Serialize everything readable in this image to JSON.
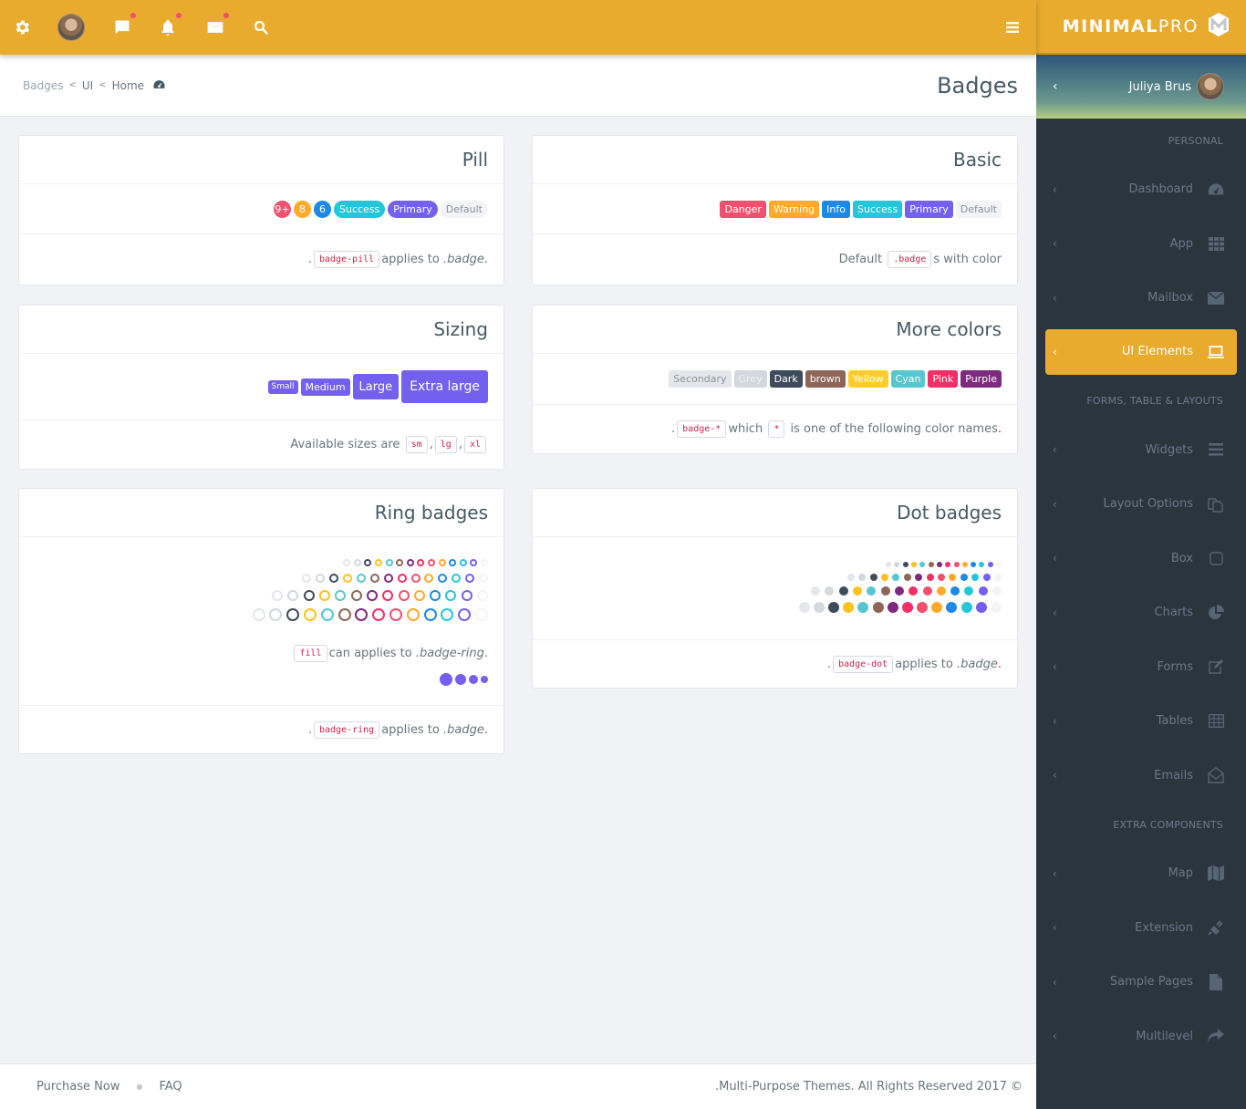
{
  "topbar": {
    "icons": [
      "gear-icon",
      "avatar",
      "chat-icon",
      "bell-icon",
      "envelope-icon",
      "search-icon"
    ],
    "menu_icon": "hamburger-icon"
  },
  "brand": {
    "bold": "MINIMAL",
    "light": "PRO"
  },
  "user": {
    "name": "Juliya Brus"
  },
  "breadcrumb": {
    "items": [
      "Badges",
      "UI",
      "Home"
    ],
    "home_icon": "dashboard-icon"
  },
  "page_title": "Badges",
  "cards": {
    "pill": {
      "title": "Pill",
      "badges": [
        {
          "label": "9+",
          "color": "#f0506e",
          "shape": "circle"
        },
        {
          "label": "8",
          "color": "#ffaa2b",
          "shape": "circle"
        },
        {
          "label": "6",
          "color": "#1e88e5",
          "shape": "circle"
        },
        {
          "label": "Success",
          "color": "#26c6da",
          "shape": "pill"
        },
        {
          "label": "Primary",
          "color": "#7460ee",
          "shape": "pill"
        },
        {
          "label": "Default",
          "color": "#f3f4f7",
          "text_color": "#8a939b",
          "shape": "pill"
        }
      ],
      "footer": {
        "code": "badge-pill",
        "text": "applies to",
        "ref": ".badge"
      }
    },
    "basic": {
      "title": "Basic",
      "badges": [
        {
          "label": "Danger",
          "color": "#f0506e"
        },
        {
          "label": "Warning",
          "color": "#ffaa2b"
        },
        {
          "label": "Info",
          "color": "#1e88e5"
        },
        {
          "label": "Success",
          "color": "#26c6da"
        },
        {
          "label": "Primary",
          "color": "#7460ee"
        },
        {
          "label": "Default",
          "color": "#f3f4f7",
          "text_color": "#8a939b"
        }
      ],
      "footer": {
        "pre": "Default",
        "code": ".badge",
        "post": "s with color"
      }
    },
    "sizing": {
      "title": "Sizing",
      "badges": [
        {
          "label": "Small",
          "size": "sm"
        },
        {
          "label": "Medium",
          "size": "md"
        },
        {
          "label": "Large",
          "size": "lg"
        },
        {
          "label": "Extra large",
          "size": "xl"
        }
      ],
      "color": "#7460ee",
      "footer": {
        "text": "Available sizes are",
        "codes": [
          "sm",
          "lg",
          "xl"
        ]
      }
    },
    "more_colors": {
      "title": "More colors",
      "badges": [
        {
          "label": "Secondary",
          "color": "#e4e6eb",
          "text_color": "#8a939b"
        },
        {
          "label": "Grey",
          "color": "#d3d7de",
          "text_color": "#eef0f3"
        },
        {
          "label": "Dark",
          "color": "#3e4b5b"
        },
        {
          "label": "brown",
          "color": "#8d6658"
        },
        {
          "label": "Yellow",
          "color": "#ffcd28"
        },
        {
          "label": "Cyan",
          "color": "#56c6d0"
        },
        {
          "label": "Pink",
          "color": "#f42e66"
        },
        {
          "label": "Purple",
          "color": "#7e2a7e"
        }
      ],
      "footer": {
        "code1": "badge-*",
        "text1": "which",
        "code2": "*",
        "text2": "is one of the following color names"
      }
    },
    "ring": {
      "title": "Ring badges",
      "colors": [
        "#e4e6eb",
        "#d3d7de",
        "#3e4b5b",
        "#ffc11e",
        "#56c6d0",
        "#8d6658",
        "#7e2a7e",
        "#f42e66",
        "#f0506e",
        "#ffaa2b",
        "#1e88e5",
        "#26c6da",
        "#7460ee",
        "#f3f4f7"
      ],
      "fill_note": {
        "code": "fill",
        "text": "can applies to",
        "ref": ".badge-ring"
      },
      "fill_color": "#7460ee",
      "footer": {
        "code": "badge-ring",
        "text": "applies to",
        "ref": ".badge"
      }
    },
    "dot": {
      "title": "Dot badges",
      "colors": [
        "#e4e6eb",
        "#d3d7de",
        "#3e4b5b",
        "#ffc11e",
        "#56c6d0",
        "#8d6658",
        "#7e2a7e",
        "#f42e66",
        "#f0506e",
        "#ffaa2b",
        "#1e88e5",
        "#26c6da",
        "#7460ee",
        "#f3f4f7"
      ],
      "footer": {
        "code": "badge-dot",
        "text": "applies to",
        "ref": ".badge"
      }
    }
  },
  "sidebar": {
    "sections": [
      {
        "header": "PERSONAL",
        "items": [
          {
            "label": "Dashboard",
            "icon": "dashboard-icon"
          },
          {
            "label": "App",
            "icon": "grid-icon"
          },
          {
            "label": "Mailbox",
            "icon": "envelope-icon"
          },
          {
            "label": "UI Elements",
            "icon": "laptop-icon",
            "active": true
          }
        ]
      },
      {
        "header": "FORMS, TABLE & LAYOUTS",
        "items": [
          {
            "label": "Widgets",
            "icon": "bars-icon"
          },
          {
            "label": "Layout Options",
            "icon": "copy-icon"
          },
          {
            "label": "Box",
            "icon": "square-icon"
          },
          {
            "label": "Charts",
            "icon": "pie-chart-icon"
          },
          {
            "label": "Forms",
            "icon": "edit-icon"
          },
          {
            "label": "Tables",
            "icon": "table-icon"
          },
          {
            "label": "Emails",
            "icon": "envelope-open-icon"
          }
        ]
      },
      {
        "header": "EXTRA COMPONENTS",
        "items": [
          {
            "label": "Map",
            "icon": "map-icon"
          },
          {
            "label": "Extension",
            "icon": "plug-icon"
          },
          {
            "label": "Sample Pages",
            "icon": "file-icon"
          },
          {
            "label": "Multilevel",
            "icon": "share-icon"
          }
        ]
      }
    ],
    "accent": "#e8ab2e"
  },
  "footer": {
    "links": [
      "Purchase Now",
      "FAQ"
    ],
    "copyright": ".Multi-Purpose Themes. All Rights Reserved 2017 ©"
  }
}
